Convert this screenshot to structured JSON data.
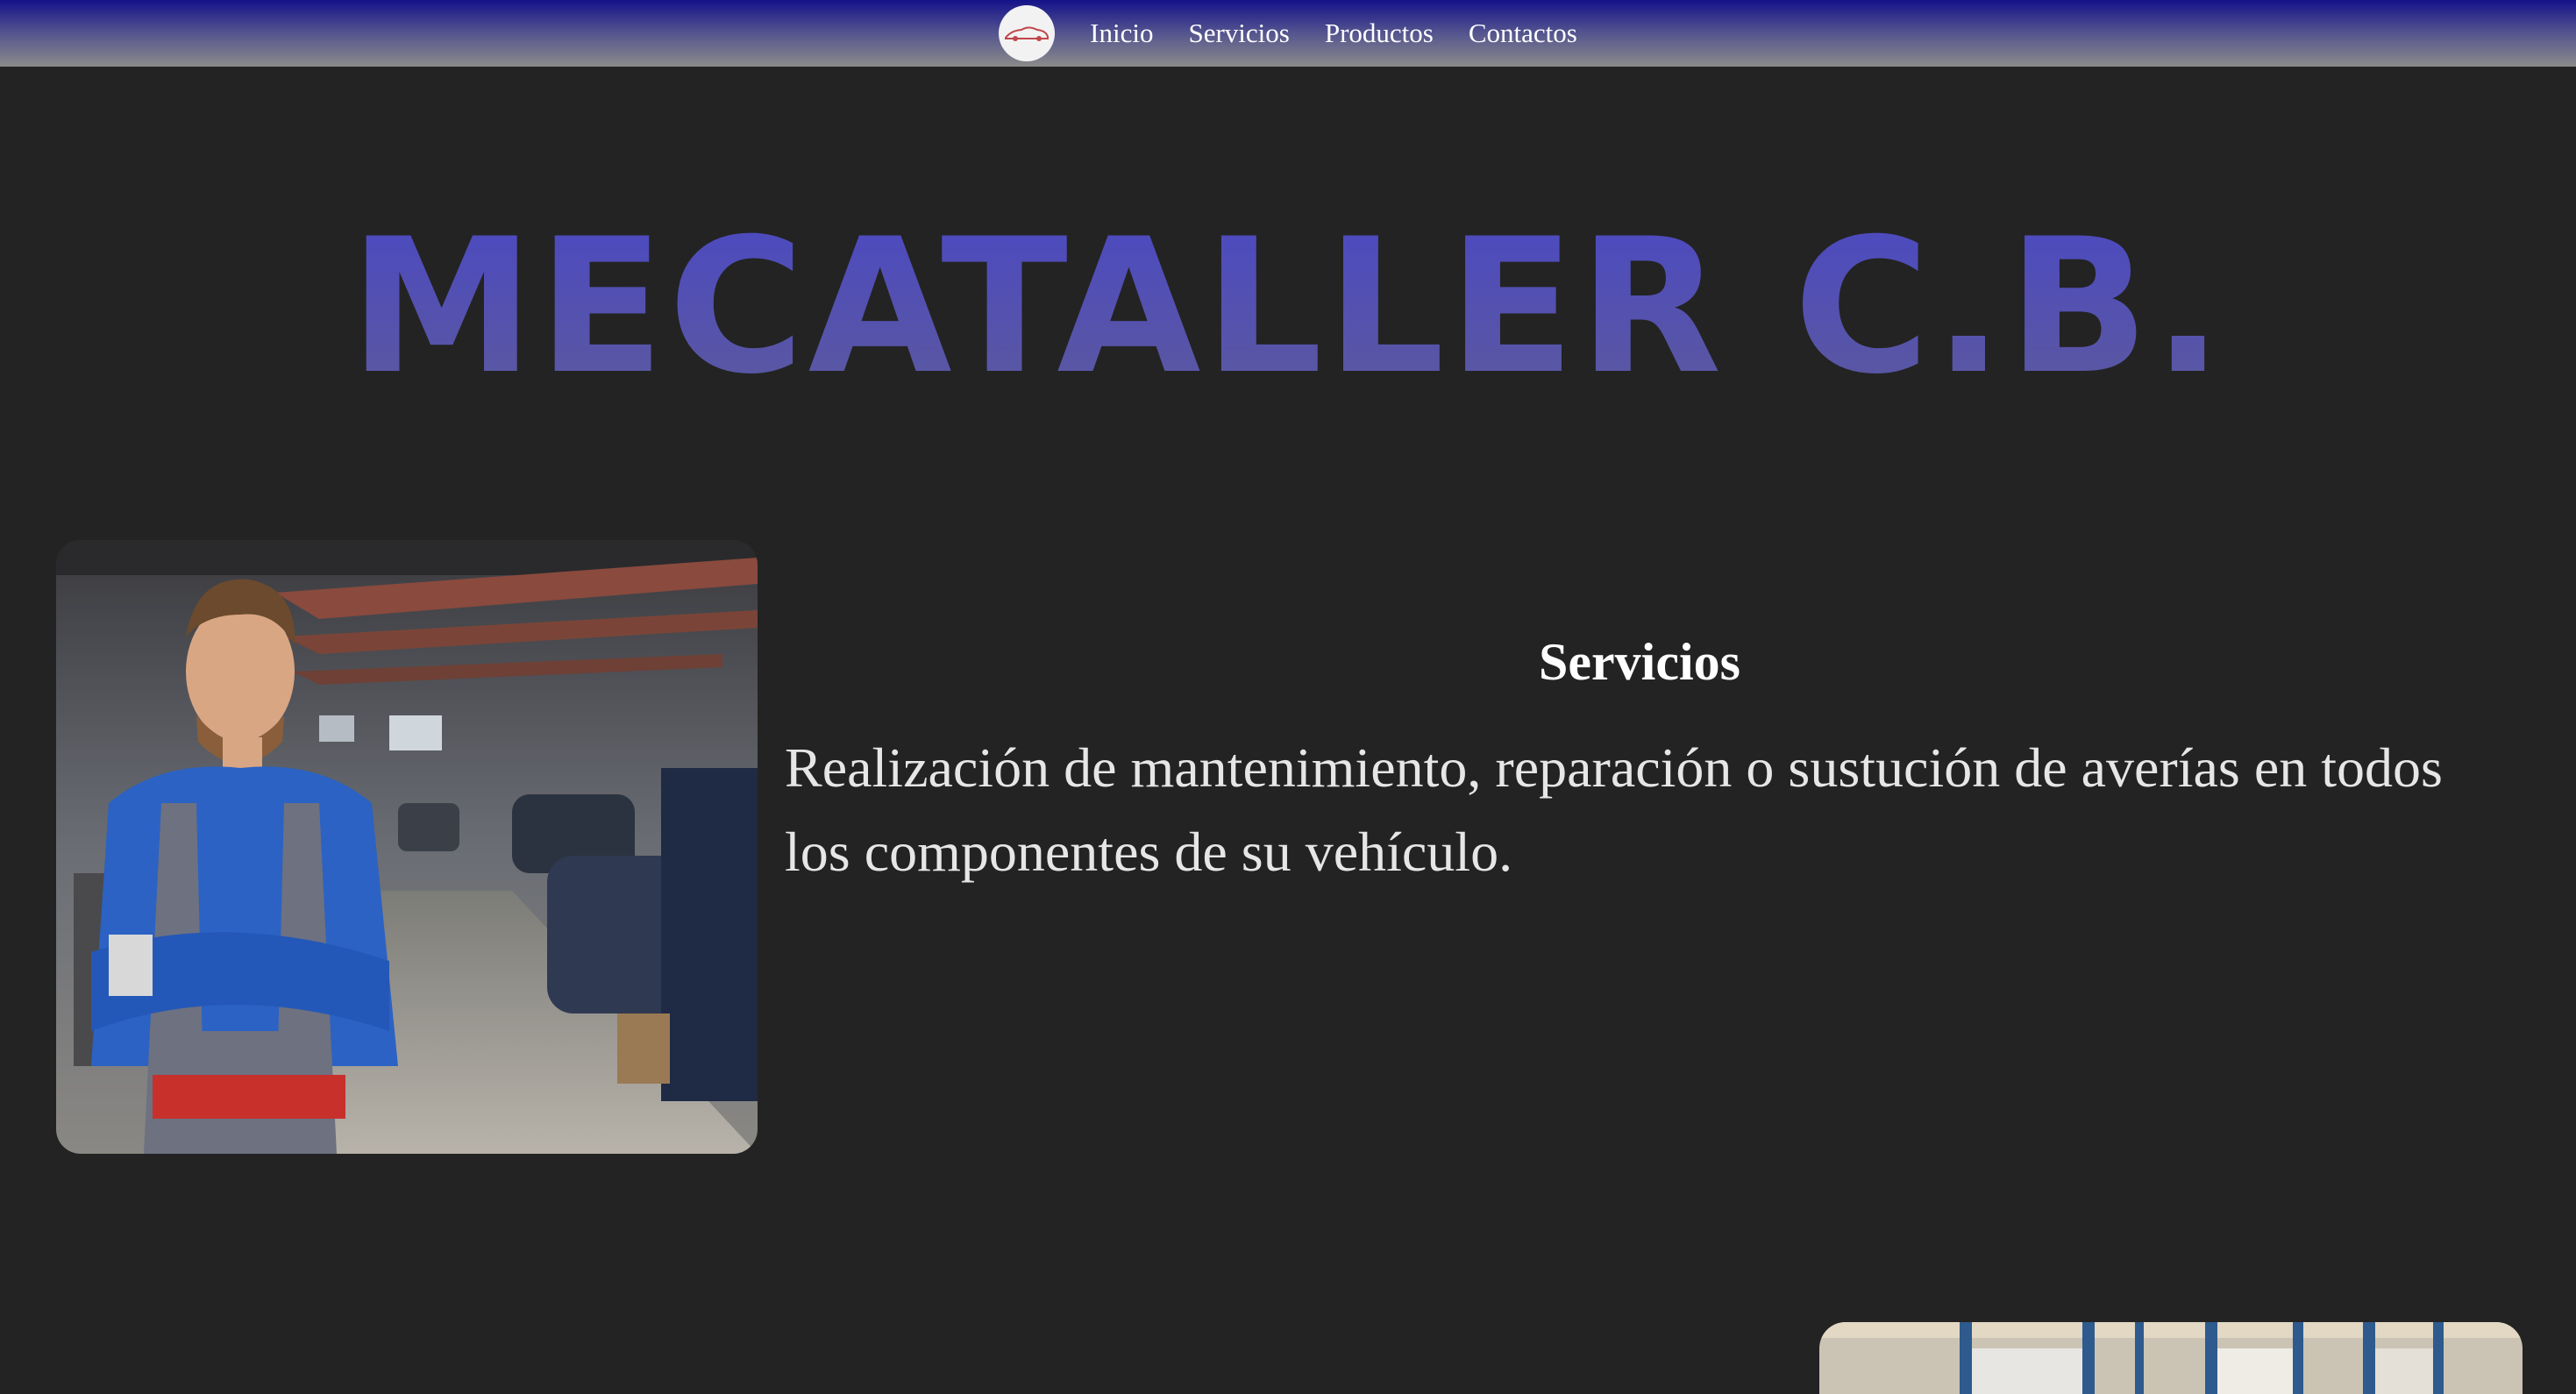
{
  "nav": {
    "logo_icon": "car-logo-icon",
    "links": [
      {
        "label": "Inicio"
      },
      {
        "label": "Servicios"
      },
      {
        "label": "Productos"
      },
      {
        "label": "Contactos"
      }
    ]
  },
  "brand": {
    "title": "MECATALLER C.B."
  },
  "services": {
    "heading": "Servicios",
    "description": "Realización de mantenimiento, reparación o sustución de averías en todos los componentes de su vehículo."
  },
  "colors": {
    "background": "#232323",
    "nav_top": "#14128a",
    "nav_bottom": "#8a8a8a",
    "title_top": "#4a48c4",
    "title_bottom": "#5d5a9c"
  }
}
